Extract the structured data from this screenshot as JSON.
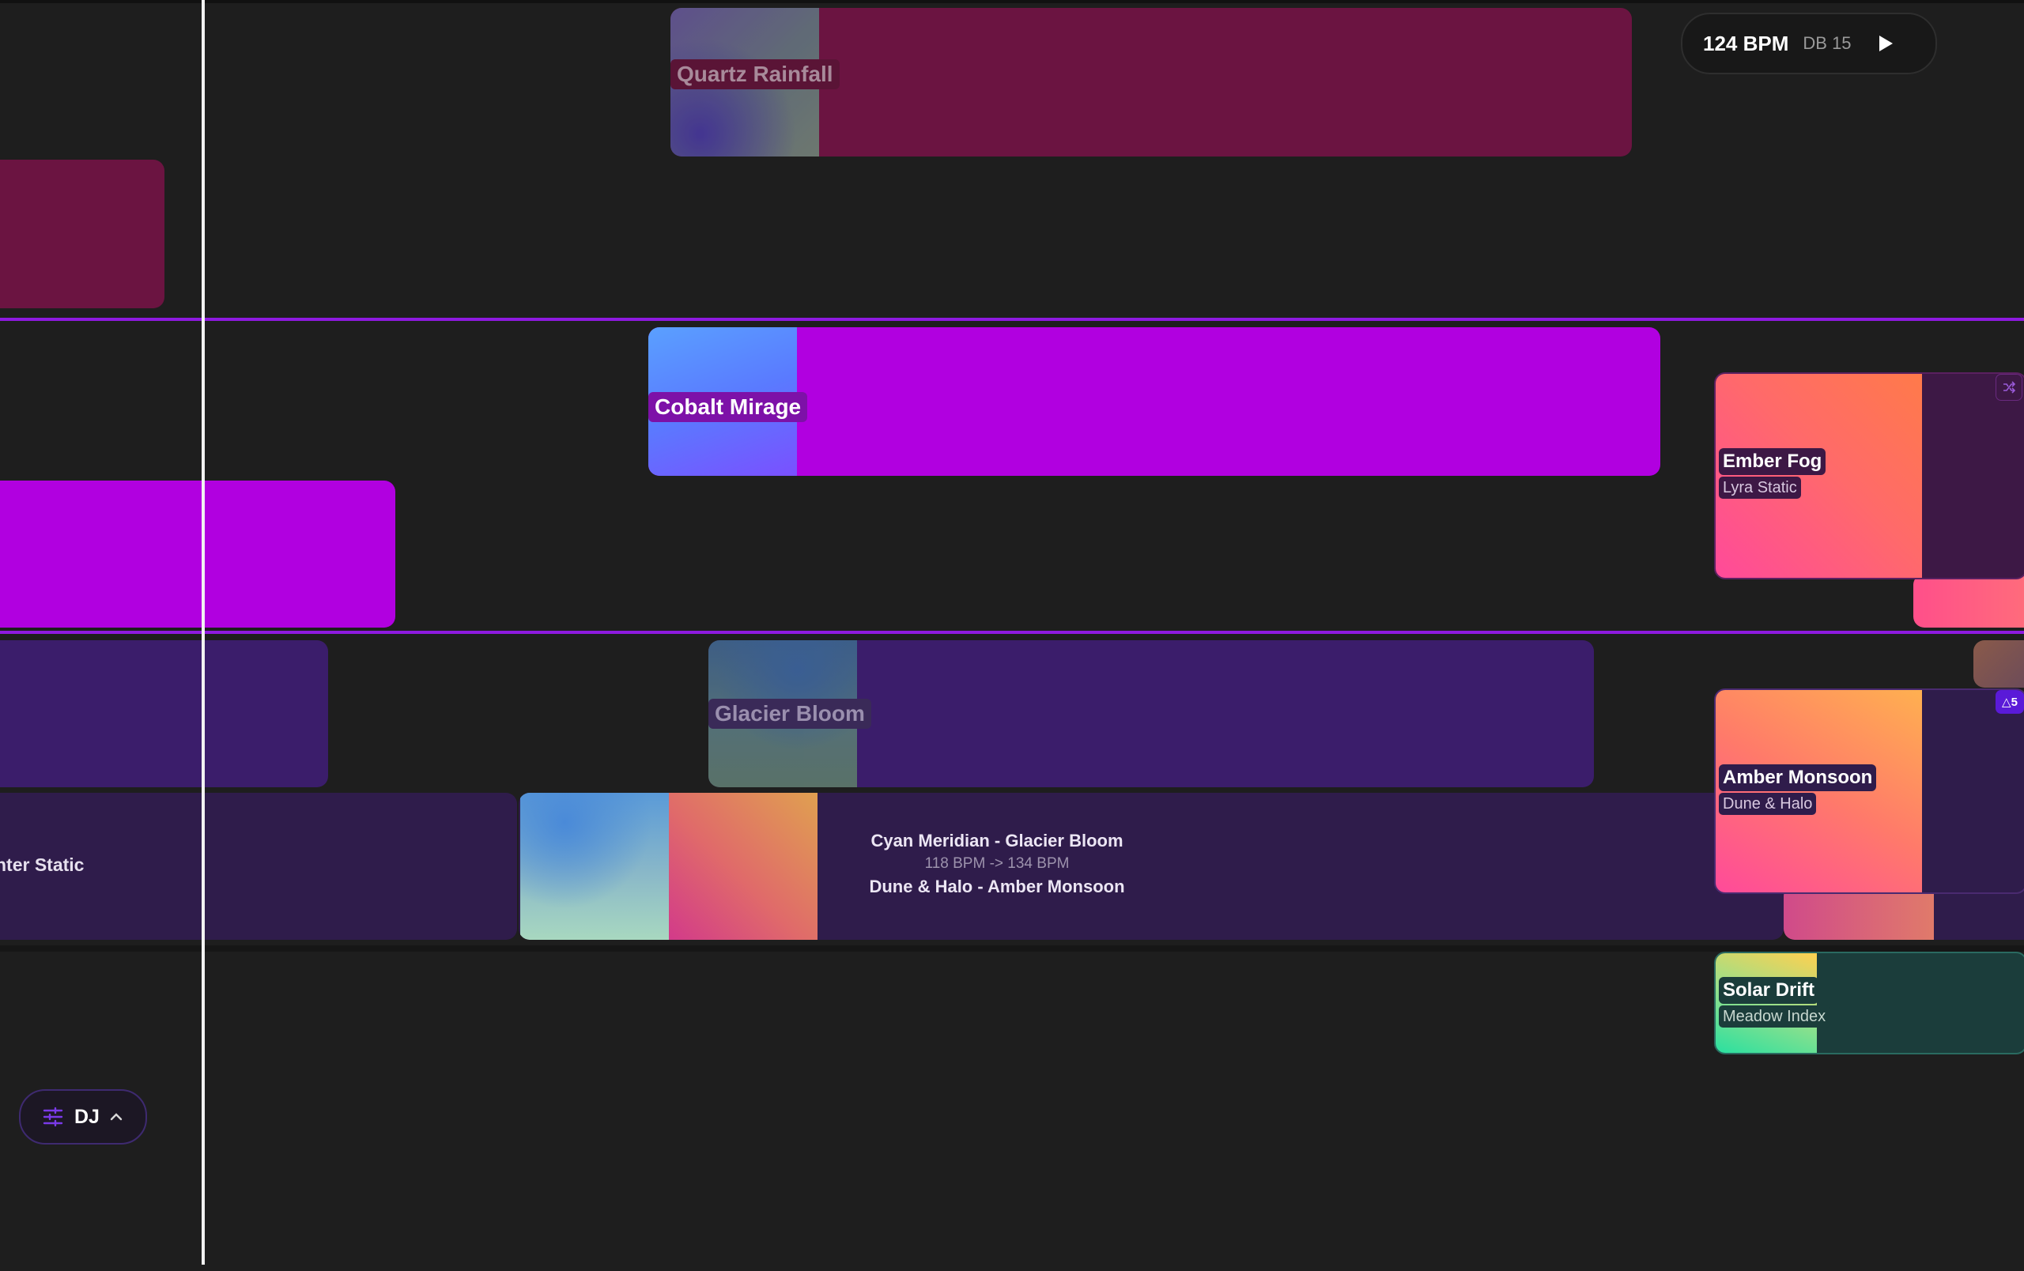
{
  "transport": {
    "bpm_label": "124 BPM",
    "db_label": "DB 15",
    "play_icon": "play-icon"
  },
  "tracks": {
    "quartz": {
      "title": "Quartz Rainfall"
    },
    "cobalt": {
      "title": "Cobalt Mirage"
    },
    "glacier": {
      "title": "Glacier Bloom"
    },
    "partial": {
      "title": "nter Static"
    }
  },
  "transition": {
    "from": "Cyan Meridian - Glacier Bloom",
    "bpm": "118 BPM -> 134 BPM",
    "to": "Dune & Halo - Amber Monsoon"
  },
  "cards": {
    "ember": {
      "title": "Ember Fog",
      "artist": "Lyra Static",
      "badge_icon": "shuffle-icon"
    },
    "amber": {
      "title": "Amber Monsoon",
      "artist": "Dune & Halo",
      "badge": "△5"
    },
    "solar": {
      "title": "Solar Drift",
      "artist": "Meadow Index"
    }
  },
  "dj_menu": {
    "label": "DJ",
    "icon": "sliders-icon",
    "chevron": "chevron-up-icon"
  },
  "colors": {
    "background": "#1e1e1e",
    "crimson": "#6b1441",
    "magenta": "#b100e0",
    "indigo": "#3b1d6b",
    "deep_purple": "#2f1c4b",
    "lane_border": "#8e1ae0",
    "teal_card": "#1b3d3b"
  }
}
